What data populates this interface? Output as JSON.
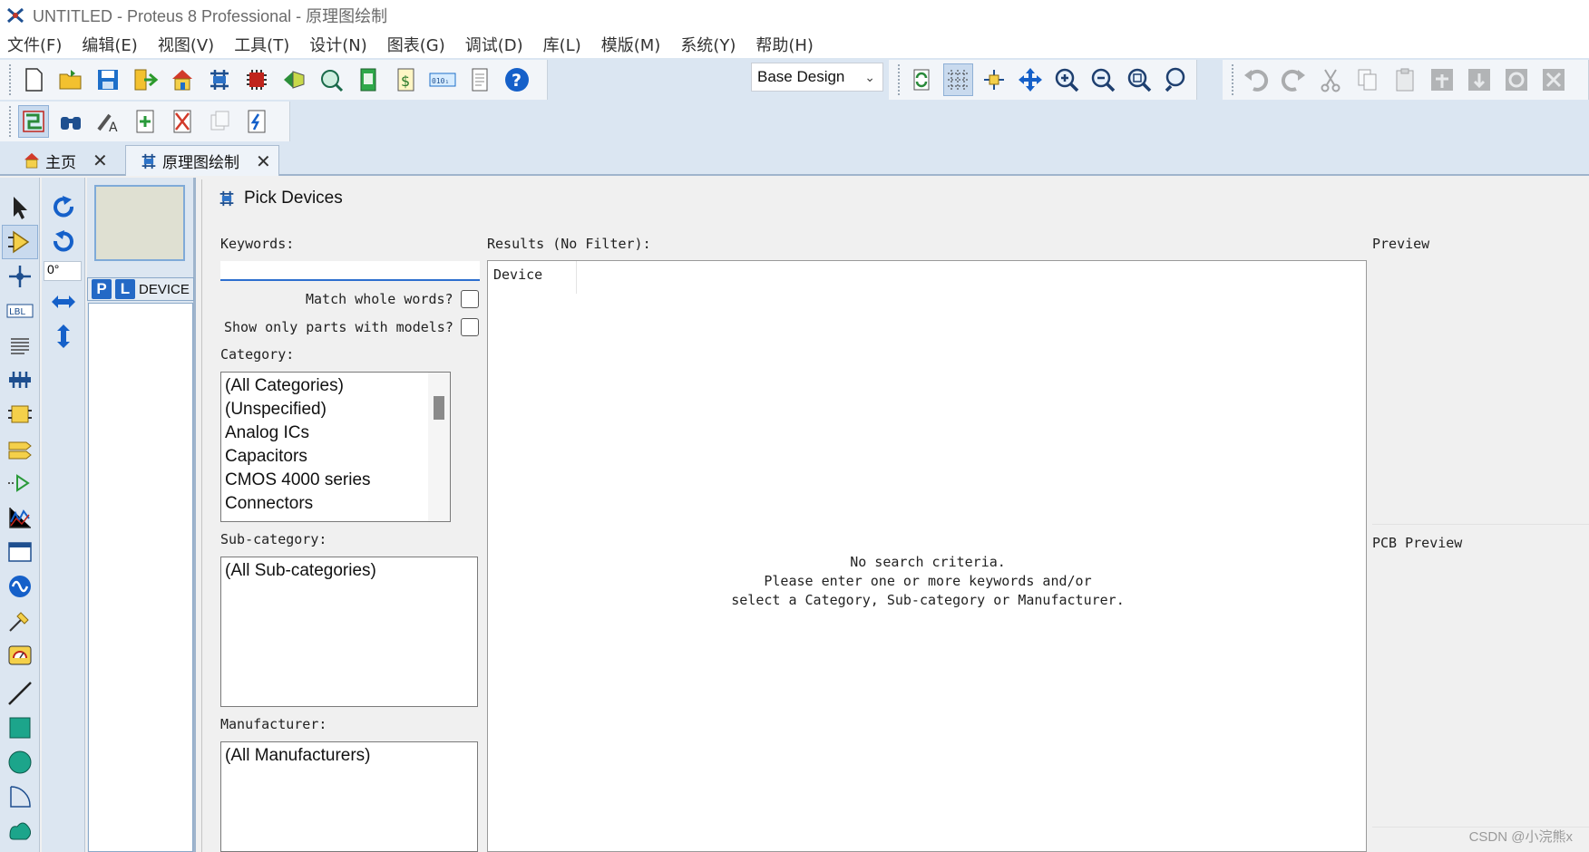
{
  "window": {
    "title": "UNTITLED - Proteus 8 Professional - 原理图绘制"
  },
  "menu": [
    "文件(F)",
    "编辑(E)",
    "视图(V)",
    "工具(T)",
    "设计(N)",
    "图表(G)",
    "调试(D)",
    "库(L)",
    "模版(M)",
    "系统(Y)",
    "帮助(H)"
  ],
  "toolbar": {
    "design_select": "Base Design"
  },
  "tabs": [
    {
      "label": "主页"
    },
    {
      "label": "原理图绘制"
    }
  ],
  "rotation": {
    "angle": "0°"
  },
  "object_selector": {
    "p_button": "P",
    "l_button": "L",
    "label": "DEVICES"
  },
  "dialog": {
    "title": "Pick Devices",
    "keywords_label": "Keywords:",
    "keywords_value": "",
    "match_whole_words": "Match whole words?",
    "show_only_models": "Show only parts with models?",
    "category_label": "Category:",
    "categories": [
      "(All Categories)",
      "(Unspecified)",
      "Analog ICs",
      "Capacitors",
      "CMOS 4000 series",
      "Connectors"
    ],
    "subcategory_label": "Sub-category:",
    "subcategories": [
      "(All Sub-categories)"
    ],
    "manufacturer_label": "Manufacturer:",
    "manufacturers": [
      "(All Manufacturers)"
    ],
    "results_label": "Results (No Filter):",
    "results_column": "Device",
    "no_search_line1": "No search criteria.",
    "no_search_line2": "Please enter one or more keywords and/or",
    "no_search_line3": "select a Category, Sub-category or Manufacturer.",
    "preview_label": "Preview",
    "pcb_preview_label": "PCB Preview"
  },
  "watermark": "CSDN @小浣熊x"
}
